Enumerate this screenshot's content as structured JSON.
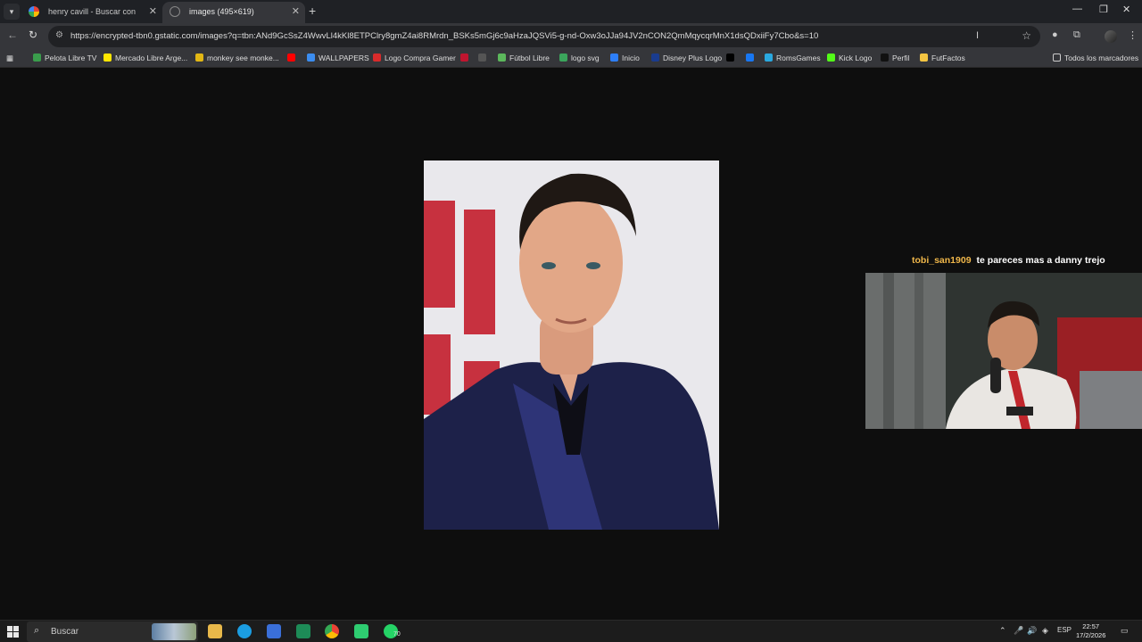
{
  "browser": {
    "tabs": [
      {
        "title": "henry cavill - Buscar con Google",
        "active": false
      },
      {
        "title": "images (495×619)",
        "active": true
      }
    ],
    "url": "https://encrypted-tbn0.gstatic.com/images?q=tbn:ANd9GcSsZ4WwvLl4kKl8ETPClry8gmZ4ai8RMrdn_BSKs5mGj6c9aHzaJQSVi5-g-nd-Oxw3oJJa94JV2nCON2QmMqycqrMnX1dsQDxiiFy7Cbo&s=10",
    "bookmarks": [
      {
        "label": "Pelota Libre TV",
        "color": "#3a9d4c"
      },
      {
        "label": "Mercado Libre Arge...",
        "color": "#ffe600"
      },
      {
        "label": "monkey see monke...",
        "color": "#e2b714"
      },
      {
        "label": "",
        "color": "#ff0000"
      },
      {
        "label": "WALLPAPERS",
        "color": "#3b8df0"
      },
      {
        "label": "Logo Compra Gamer",
        "color": "#d92b2b"
      },
      {
        "label": "",
        "color": "#c0152f"
      },
      {
        "label": "",
        "color": "#555555"
      },
      {
        "label": "Fútbol Libre",
        "color": "#5cb85c"
      },
      {
        "label": "logo svg",
        "color": "#3ba55c"
      },
      {
        "label": "Inicio",
        "color": "#2d7ff9"
      },
      {
        "label": "Disney Plus Logo",
        "color": "#1a3c8f"
      },
      {
        "label": "",
        "color": "#000000"
      },
      {
        "label": "",
        "color": "#1877f2"
      },
      {
        "label": "RomsGames",
        "color": "#2aa9e0"
      },
      {
        "label": "Kick Logo",
        "color": "#53fc18"
      },
      {
        "label": "Perfil",
        "color": "#111111"
      },
      {
        "label": "FutFactos",
        "color": "#f4c542"
      }
    ],
    "all_bookmarks_label": "Todos los marcadores"
  },
  "chat": {
    "username": "tobi_san1909",
    "message": "te pareces mas a danny trejo"
  },
  "taskbar": {
    "search_placeholder": "Buscar",
    "whatsapp_badge": "70",
    "language": "ESP",
    "time": "22:57",
    "date": "17/2/2026"
  },
  "colors": {
    "chat_username": "#f0b74a",
    "background": "#0e0e0e"
  }
}
